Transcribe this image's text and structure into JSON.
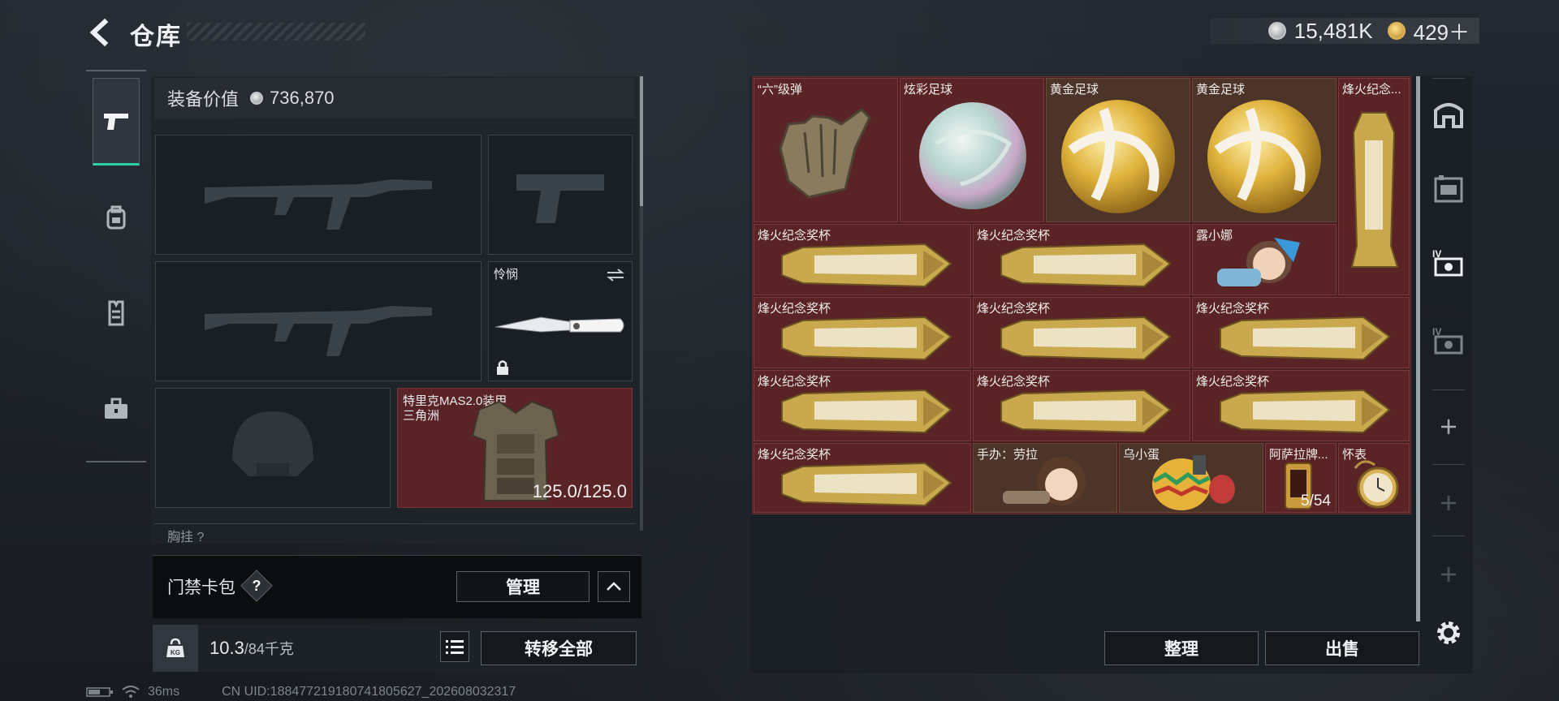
{
  "header": {
    "title": "仓库",
    "back_icon": "chevron-left-icon",
    "currencies": [
      {
        "icon": "silver-coin-icon",
        "value": "15,481K"
      },
      {
        "icon": "gold-coin-icon",
        "value": "429＋"
      }
    ]
  },
  "left_tabs": [
    {
      "name": "weapon",
      "icon": "pistol-icon",
      "active": true
    },
    {
      "name": "gear",
      "icon": "backpack-icon",
      "active": false
    },
    {
      "name": "armor",
      "icon": "vest-icon",
      "active": false
    },
    {
      "name": "kit",
      "icon": "briefcase-icon",
      "active": false
    }
  ],
  "loadout": {
    "equip_value_label": "装备价值",
    "equip_value": "736,870",
    "melee": {
      "label": "怜悯"
    },
    "armor": {
      "label": "特里克MAS2.0装甲",
      "sub": "三角洲",
      "durability": "125.0/125.0"
    },
    "chest_rig_peek": "胸挂 ?"
  },
  "keycard": {
    "label": "门禁卡包",
    "help": "?",
    "manage_label": "管理"
  },
  "weight": {
    "icon_text": "KG",
    "current": "10.3",
    "max": "/84千克",
    "transfer_all_label": "转移全部"
  },
  "status": {
    "ping": "36ms",
    "uid": "CN UID:18847721918074180562​7_202608032317"
  },
  "stash": {
    "items": [
      {
        "label": "“六”级弹",
        "kind": "gesture"
      },
      {
        "label": "炫彩足球",
        "kind": "holo-ball"
      },
      {
        "label": "黄金足球",
        "kind": "gold-ball"
      },
      {
        "label": "黄金足球",
        "kind": "gold-ball"
      },
      {
        "label": "烽火纪念...",
        "kind": "trophy-v"
      },
      {
        "label": "烽火纪念奖杯",
        "kind": "trophy"
      },
      {
        "label": "烽火纪念奖杯",
        "kind": "trophy"
      },
      {
        "label": "露小娜",
        "kind": "doll"
      },
      {
        "label": "烽火纪念奖杯",
        "kind": "trophy"
      },
      {
        "label": "烽火纪念奖杯",
        "kind": "trophy"
      },
      {
        "label": "烽火纪念奖杯",
        "kind": "trophy"
      },
      {
        "label": "烽火纪念奖杯",
        "kind": "trophy"
      },
      {
        "label": "烽火纪念奖杯",
        "kind": "trophy"
      },
      {
        "label": "烽火纪念奖杯",
        "kind": "trophy"
      },
      {
        "label": "烽火纪念奖杯",
        "kind": "trophy"
      },
      {
        "label": "手办：劳拉",
        "kind": "figure"
      },
      {
        "label": "乌小蛋",
        "kind": "egg"
      },
      {
        "label": "阿萨拉牌...",
        "kind": "card",
        "count": "5/54"
      },
      {
        "label": "怀表",
        "kind": "watch"
      }
    ],
    "organize_label": "整理",
    "sell_label": "出售"
  },
  "right_rail": [
    {
      "icon": "stash-home-icon"
    },
    {
      "icon": "storage-icon"
    },
    {
      "icon": "stash-iv-icon"
    },
    {
      "icon": "stash-iv-alt-icon"
    },
    {
      "icon": "plus-icon"
    },
    {
      "icon": "plus-icon"
    },
    {
      "icon": "plus-icon"
    },
    {
      "icon": "gear-icon"
    }
  ]
}
